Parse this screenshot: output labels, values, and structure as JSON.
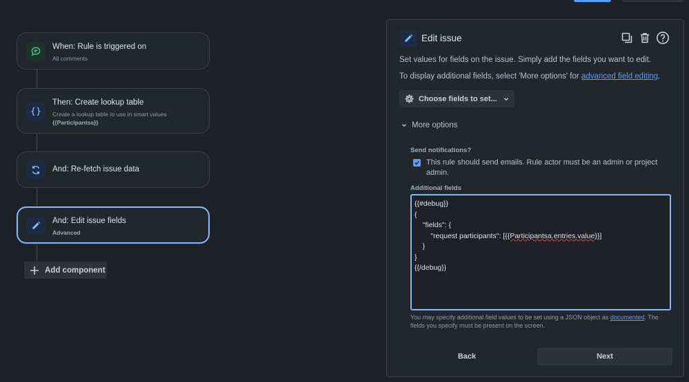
{
  "flow": {
    "nodes": [
      {
        "title": "When: Rule is triggered on",
        "subtitle": "All comments",
        "icon": "comment-trigger-icon"
      },
      {
        "title": "Then: Create lookup table",
        "subtitle": "Create a lookup table to use in smart values",
        "subtitle2": "{{Participantsa}}",
        "icon": "braces-icon"
      },
      {
        "title": "And: Re-fetch issue data",
        "icon": "refresh-icon"
      },
      {
        "title": "And: Edit issue fields",
        "subtitle": "Advanced",
        "icon": "pencil-icon"
      }
    ],
    "add_component": "Add component"
  },
  "panel": {
    "title": "Edit issue",
    "desc1": "Set values for fields on the issue. Simply add the fields you want to edit.",
    "desc2_prefix": "To display additional fields, select 'More options' for ",
    "desc2_link": "advanced field editing",
    "desc2_suffix": ".",
    "choose_fields": "Choose fields to set...",
    "more_options": "More options",
    "send_notifications_label": "Send notifications?",
    "send_notifications_text": "This rule should send emails. Rule actor must be an admin or project admin.",
    "send_notifications_checked": true,
    "additional_fields_label": "Additional fields",
    "editor_lines": {
      "l1": "{{#debug}}",
      "l2": "{",
      "l3": "    \"fields\": {",
      "l4_prefix": "        \"request participants\": [",
      "l4_squiggle": "{{Participantsa.entries.value}}",
      "l4_suffix": "]",
      "l5": "    }",
      "l6": "}",
      "l7": "{{/debug}}"
    },
    "help_prefix": "You may specify additional field values to be set using a JSON object as ",
    "help_link": "documented",
    "help_suffix": ". The fields you specify must be present on the screen.",
    "back": "Back",
    "next": "Next"
  },
  "colors": {
    "background": "#1d2125",
    "panel": "#22272b",
    "accent": "#579dff",
    "active_border": "#85b8ff",
    "trigger_icon": "#4bce97"
  }
}
